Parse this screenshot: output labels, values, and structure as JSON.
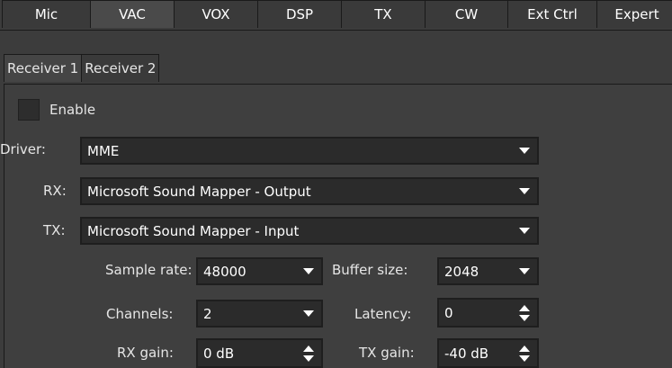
{
  "top_tabs": [
    "Mic",
    "VAC",
    "VOX",
    "DSP",
    "TX",
    "CW",
    "Ext Ctrl",
    "Expert"
  ],
  "sub_tabs": [
    "Receiver 1",
    "Receiver 2"
  ],
  "enable": {
    "label": "Enable",
    "checked": false
  },
  "driver": {
    "label": "Driver:",
    "value": "MME"
  },
  "rx": {
    "label": "RX:",
    "value": "Microsoft Sound Mapper - Output"
  },
  "tx": {
    "label": "TX:",
    "value": "Microsoft Sound Mapper - Input"
  },
  "sample_rate": {
    "label": "Sample rate:",
    "value": "48000"
  },
  "buffer_size": {
    "label": "Buffer size:",
    "value": "2048"
  },
  "channels": {
    "label": "Channels:",
    "value": "2"
  },
  "latency": {
    "label": "Latency:",
    "value": "0"
  },
  "rx_gain": {
    "label": "RX gain:",
    "value": "0 dB"
  },
  "tx_gain": {
    "label": "TX gain:",
    "value": "-40 dB"
  }
}
